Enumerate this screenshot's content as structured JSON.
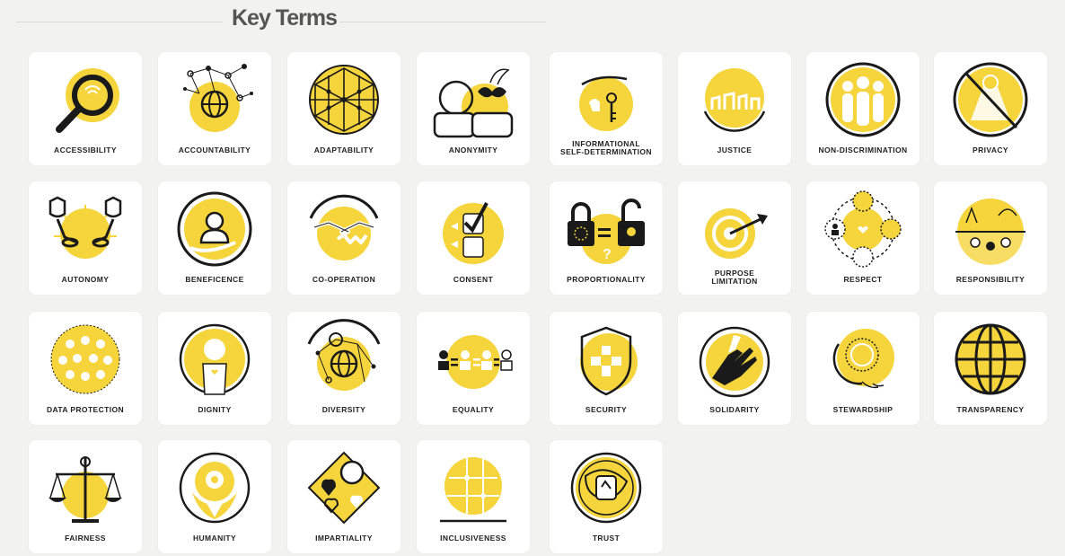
{
  "header": {
    "title": "Key Terms"
  },
  "colors": {
    "accent": "#f5d43c",
    "ink": "#1a1a1a",
    "card": "#ffffff",
    "background": "#f2f2f0"
  },
  "terms": [
    {
      "label": "ACCESSIBILITY",
      "icon": "magnifier-icon"
    },
    {
      "label": "ACCOUNTABILITY",
      "icon": "network-globe-icon"
    },
    {
      "label": "ADAPTABILITY",
      "icon": "geodesic-sphere-icon"
    },
    {
      "label": "ANONYMITY",
      "icon": "mask-icon"
    },
    {
      "label": "INFORMATIONAL\nSELF-DETERMINATION",
      "icon": "key-hand-icon"
    },
    {
      "label": "JUSTICE",
      "icon": "raised-fists-icon"
    },
    {
      "label": "NON-DISCRIMINATION",
      "icon": "people-group-icon"
    },
    {
      "label": "PRIVACY",
      "icon": "no-surveillance-icon"
    },
    {
      "label": "AUTONOMY",
      "icon": "broken-chains-icon"
    },
    {
      "label": "BENEFICENCE",
      "icon": "caring-hand-icon"
    },
    {
      "label": "CO-OPERATION",
      "icon": "handshake-icon"
    },
    {
      "label": "CONSENT",
      "icon": "checkbox-icon"
    },
    {
      "label": "PROPORTIONALITY",
      "icon": "padlocks-icon"
    },
    {
      "label": "PURPOSE\nLIMITATION",
      "icon": "target-icon"
    },
    {
      "label": "RESPECT",
      "icon": "people-circle-icon"
    },
    {
      "label": "RESPONSIBILITY",
      "icon": "community-icon"
    },
    {
      "label": "DATA PROTECTION",
      "icon": "data-crowd-icon"
    },
    {
      "label": "DIGNITY",
      "icon": "radiant-person-icon"
    },
    {
      "label": "DIVERSITY",
      "icon": "diverse-network-icon"
    },
    {
      "label": "EQUALITY",
      "icon": "equal-people-icon"
    },
    {
      "label": "SECURITY",
      "icon": "shield-icon"
    },
    {
      "label": "SOLIDARITY",
      "icon": "joined-hands-icon"
    },
    {
      "label": "STEWARDSHIP",
      "icon": "holding-globe-icon"
    },
    {
      "label": "TRANSPARENCY",
      "icon": "globe-icon"
    },
    {
      "label": "FAIRNESS",
      "icon": "scales-icon"
    },
    {
      "label": "HUMANITY",
      "icon": "embrace-icon"
    },
    {
      "label": "IMPARTIALITY",
      "icon": "hearts-icon"
    },
    {
      "label": "INCLUSIVENESS",
      "icon": "puzzle-globe-icon"
    },
    {
      "label": "TRUST",
      "icon": "trust-knot-icon"
    }
  ]
}
